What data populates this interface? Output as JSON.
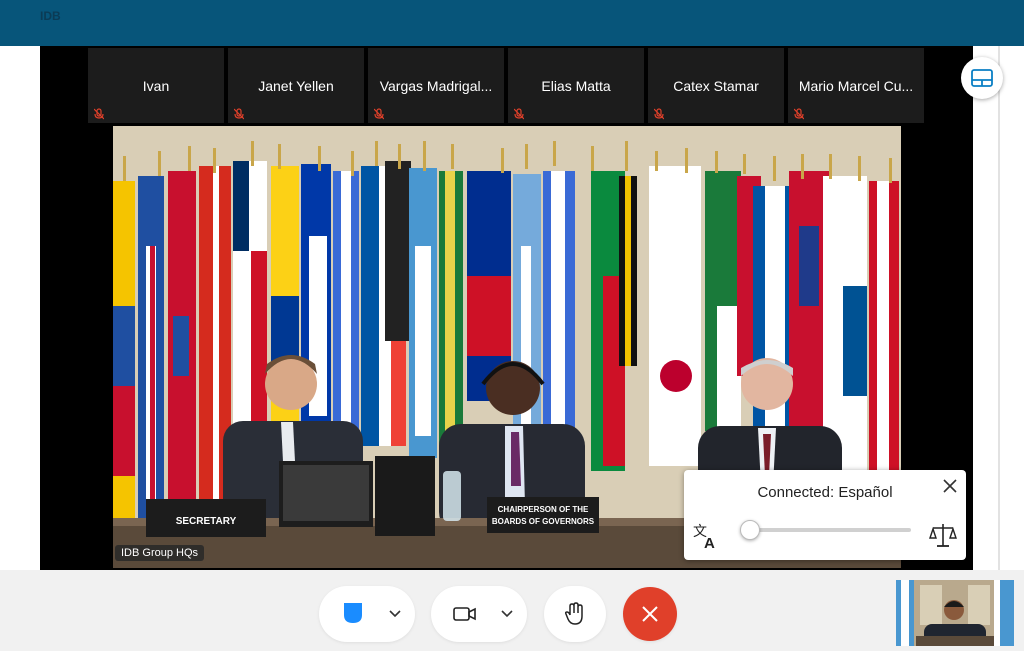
{
  "window": {
    "title": "IDB"
  },
  "participants": [
    {
      "name": "Ivan"
    },
    {
      "name": "Janet Yellen"
    },
    {
      "name": "Vargas Madrigal..."
    },
    {
      "name": "Elias Matta"
    },
    {
      "name": "Catex Stamar"
    },
    {
      "name": "Mario Marcel Cu..."
    }
  ],
  "main_video": {
    "location_label": "IDB Group HQs",
    "placards": {
      "left": "SECRETARY",
      "center_line1": "CHAIRPERSON OF THE",
      "center_line2": "BOARDS OF GOVERNORS"
    }
  },
  "interpretation": {
    "status": "Connected: Español",
    "volume_percent": 5
  },
  "icons": {
    "layout": "layout-icon",
    "mute": "muted-mic-icon",
    "close": "close-icon",
    "translate": "translate-icon",
    "balance": "balance-icon",
    "mic": "microphone-icon",
    "camera": "camera-icon",
    "hand": "raise-hand-icon",
    "leave": "leave-icon",
    "chevron": "chevron-down-icon"
  },
  "colors": {
    "header": "#07557a",
    "mic_active": "#1a8cff",
    "leave": "#e0402a",
    "mute_icon": "#e0402a"
  }
}
